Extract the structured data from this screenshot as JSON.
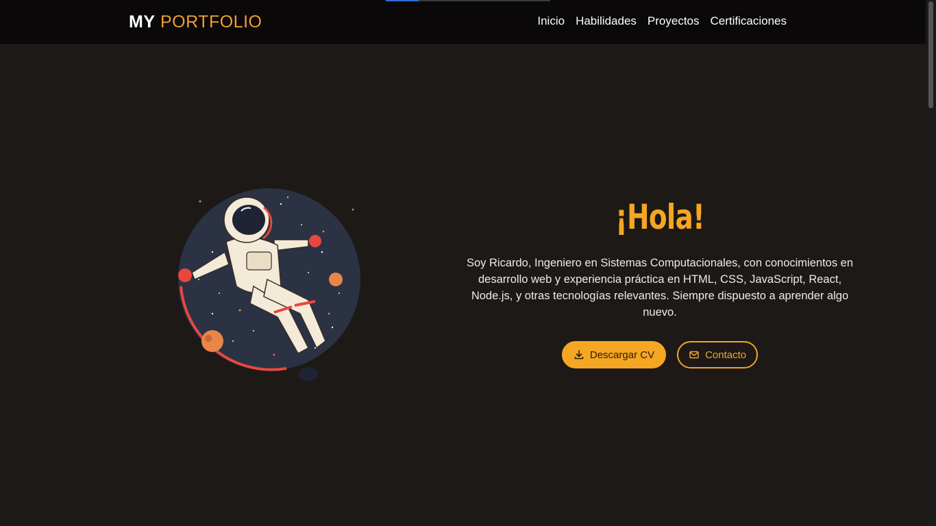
{
  "header": {
    "brand_primary": "MY",
    "brand_accent": "PORTFOLIO",
    "nav": [
      {
        "label": "Inicio"
      },
      {
        "label": "Habilidades"
      },
      {
        "label": "Proyectos"
      },
      {
        "label": "Certificaciones"
      }
    ]
  },
  "hero": {
    "title": "¡Hola!",
    "description": "Soy Ricardo, Ingeniero en Sistemas Computacionales, con conocimientos en desarrollo web y experiencia práctica en HTML, CSS, JavaScript, React, Node.js, y otras tecnologías relevantes. Siempre dispuesto a aprender algo nuevo.",
    "download_label": "Descargar CV",
    "contact_label": "Contacto",
    "illustration": "astronaut-floating-in-space"
  },
  "colors": {
    "background": "#1d1917",
    "header_bg": "#0a0808",
    "accent": "#f5a623",
    "text": "#ececec"
  },
  "icons": {
    "download": "download-icon",
    "contact": "mail-icon"
  }
}
